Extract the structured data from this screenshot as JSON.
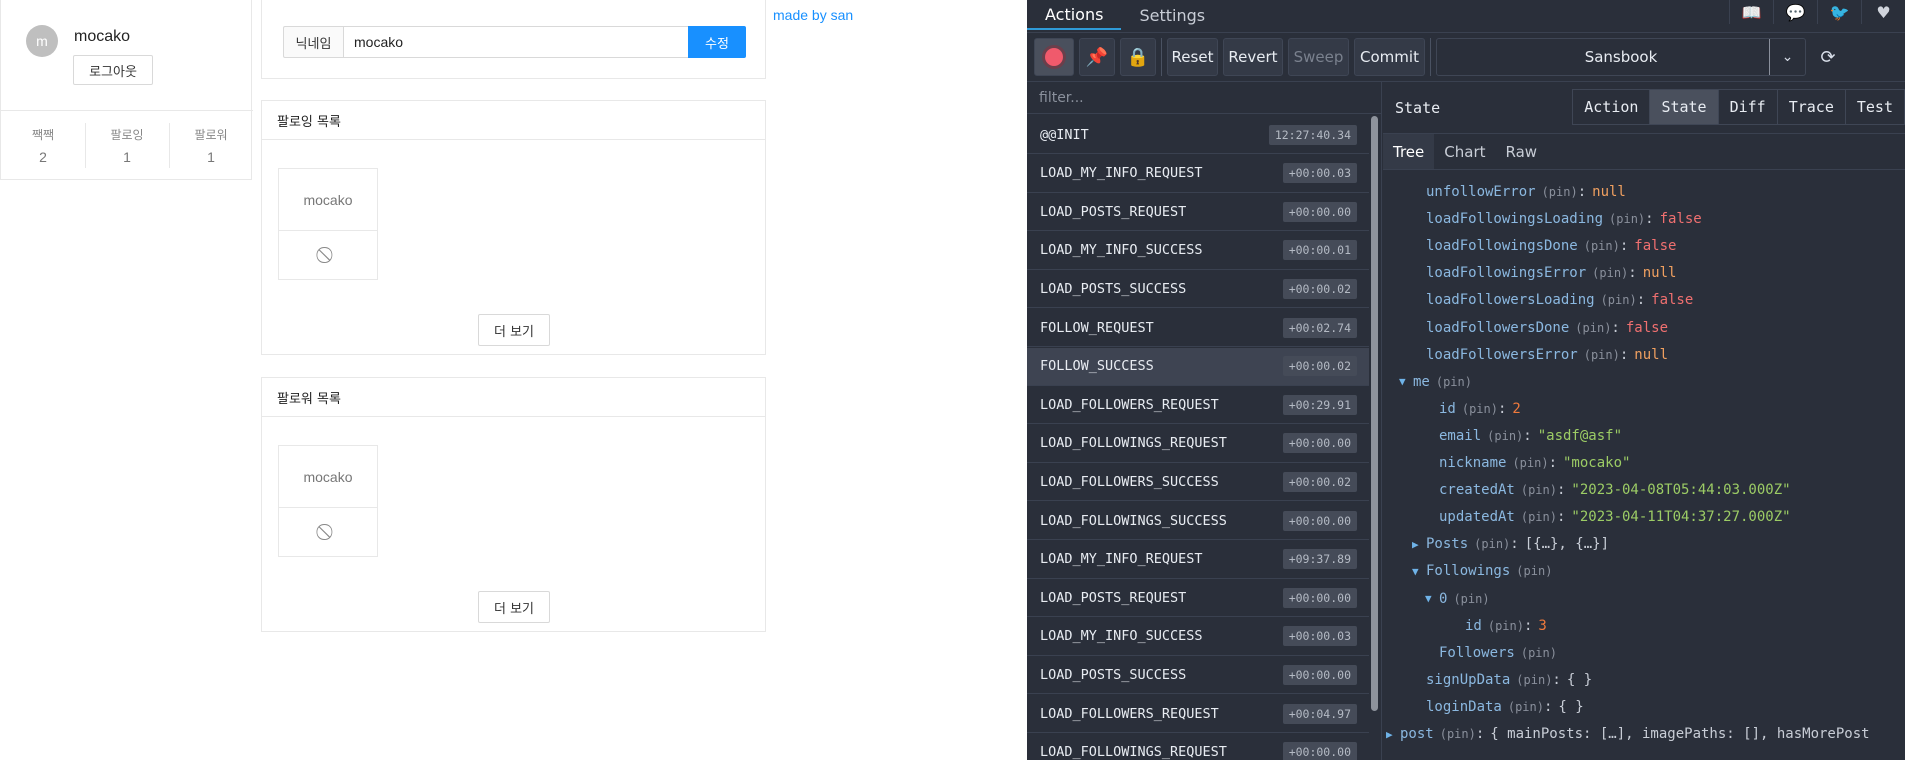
{
  "app": {
    "profile": {
      "avatar_letter": "m",
      "name": "mocako",
      "logout_label": "로그아웃",
      "stats": [
        {
          "label": "짹짹",
          "value": "2"
        },
        {
          "label": "팔로잉",
          "value": "1"
        },
        {
          "label": "팔로워",
          "value": "1"
        }
      ]
    },
    "nickname_form": {
      "addon_label": "닉네임",
      "value": "mocako",
      "submit_label": "수정"
    },
    "following_list": {
      "title": "팔로잉 목록",
      "user": "mocako",
      "more_label": "더 보기"
    },
    "follower_list": {
      "title": "팔로워 목록",
      "user": "mocako",
      "more_label": "더 보기"
    },
    "made_by": "made by san"
  },
  "devtools": {
    "tabs": [
      "Actions",
      "Settings"
    ],
    "toolbar": {
      "reset": "Reset",
      "revert": "Revert",
      "sweep": "Sweep",
      "commit": "Commit",
      "instance": "Sansbook"
    },
    "filter_placeholder": "filter...",
    "actions": [
      {
        "name": "@@INIT",
        "time": "12:27:40.34"
      },
      {
        "name": "LOAD_MY_INFO_REQUEST",
        "time": "+00:00.03"
      },
      {
        "name": "LOAD_POSTS_REQUEST",
        "time": "+00:00.00"
      },
      {
        "name": "LOAD_MY_INFO_SUCCESS",
        "time": "+00:00.01"
      },
      {
        "name": "LOAD_POSTS_SUCCESS",
        "time": "+00:00.02"
      },
      {
        "name": "FOLLOW_REQUEST",
        "time": "+00:02.74"
      },
      {
        "name": "FOLLOW_SUCCESS",
        "time": "+00:00.02"
      },
      {
        "name": "LOAD_FOLLOWERS_REQUEST",
        "time": "+00:29.91"
      },
      {
        "name": "LOAD_FOLLOWINGS_REQUEST",
        "time": "+00:00.00"
      },
      {
        "name": "LOAD_FOLLOWERS_SUCCESS",
        "time": "+00:00.02"
      },
      {
        "name": "LOAD_FOLLOWINGS_SUCCESS",
        "time": "+00:00.00"
      },
      {
        "name": "LOAD_MY_INFO_REQUEST",
        "time": "+09:37.89"
      },
      {
        "name": "LOAD_POSTS_REQUEST",
        "time": "+00:00.00"
      },
      {
        "name": "LOAD_MY_INFO_SUCCESS",
        "time": "+00:00.03"
      },
      {
        "name": "LOAD_POSTS_SUCCESS",
        "time": "+00:00.00"
      },
      {
        "name": "LOAD_FOLLOWERS_REQUEST",
        "time": "+00:04.97"
      },
      {
        "name": "LOAD_FOLLOWINGS_REQUEST",
        "time": "+00:00.00"
      }
    ],
    "selected_action": "FOLLOW_SUCCESS",
    "state_title": "State",
    "mode_tabs": [
      "Action",
      "State",
      "Diff",
      "Trace",
      "Test"
    ],
    "active_mode": "State",
    "sub_tabs": [
      "Tree",
      "Chart",
      "Raw"
    ],
    "active_sub_tab": "Tree",
    "pin_label": "(pin)",
    "tree": [
      {
        "key": "unfollowError",
        "value": "null",
        "kind": "null",
        "indent": 1
      },
      {
        "key": "loadFollowingsLoading",
        "value": "false",
        "kind": "false",
        "indent": 1
      },
      {
        "key": "loadFollowingsDone",
        "value": "false",
        "kind": "false",
        "indent": 1
      },
      {
        "key": "loadFollowingsError",
        "value": "null",
        "kind": "null",
        "indent": 1
      },
      {
        "key": "loadFollowersLoading",
        "value": "false",
        "kind": "false",
        "indent": 1
      },
      {
        "key": "loadFollowersDone",
        "value": "false",
        "kind": "false",
        "indent": 1
      },
      {
        "key": "loadFollowersError",
        "value": "null",
        "kind": "null",
        "indent": 1
      },
      {
        "key": "me",
        "value": "",
        "kind": "open",
        "indent": 0
      },
      {
        "key": "id",
        "value": "2",
        "kind": "num",
        "indent": 2
      },
      {
        "key": "email",
        "value": "\"asdf@asf\"",
        "kind": "str",
        "indent": 2
      },
      {
        "key": "nickname",
        "value": "\"mocako\"",
        "kind": "str",
        "indent": 2
      },
      {
        "key": "createdAt",
        "value": "\"2023-04-08T05:44:03.000Z\"",
        "kind": "str",
        "indent": 2
      },
      {
        "key": "updatedAt",
        "value": "\"2023-04-11T04:37:27.000Z\"",
        "kind": "str",
        "indent": 2
      },
      {
        "key": "Posts",
        "value": "[{…}, {…}]",
        "kind": "closed",
        "indent": 1
      },
      {
        "key": "Followings",
        "value": "",
        "kind": "open",
        "indent": 1
      },
      {
        "key": "0",
        "value": "",
        "kind": "open",
        "indent": 2
      },
      {
        "key": "id",
        "value": "3",
        "kind": "num",
        "indent": 4
      },
      {
        "key": "Followers",
        "value": "",
        "kind": "plain",
        "indent": 2
      },
      {
        "key": "signUpData",
        "value": "{ }",
        "kind": "obj",
        "indent": 1
      },
      {
        "key": "loginData",
        "value": "{ }",
        "kind": "obj",
        "indent": 1
      },
      {
        "key": "post",
        "value": "{ mainPosts: […], imagePaths: [], hasMorePost",
        "kind": "closed",
        "indent": -1
      }
    ],
    "colors": {
      "background": "#2a2f3a",
      "accent": "#2f9bd8",
      "record": "#f05a6c",
      "string": "#9ccc65",
      "false": "#f07070",
      "null": "#f0a060"
    }
  }
}
